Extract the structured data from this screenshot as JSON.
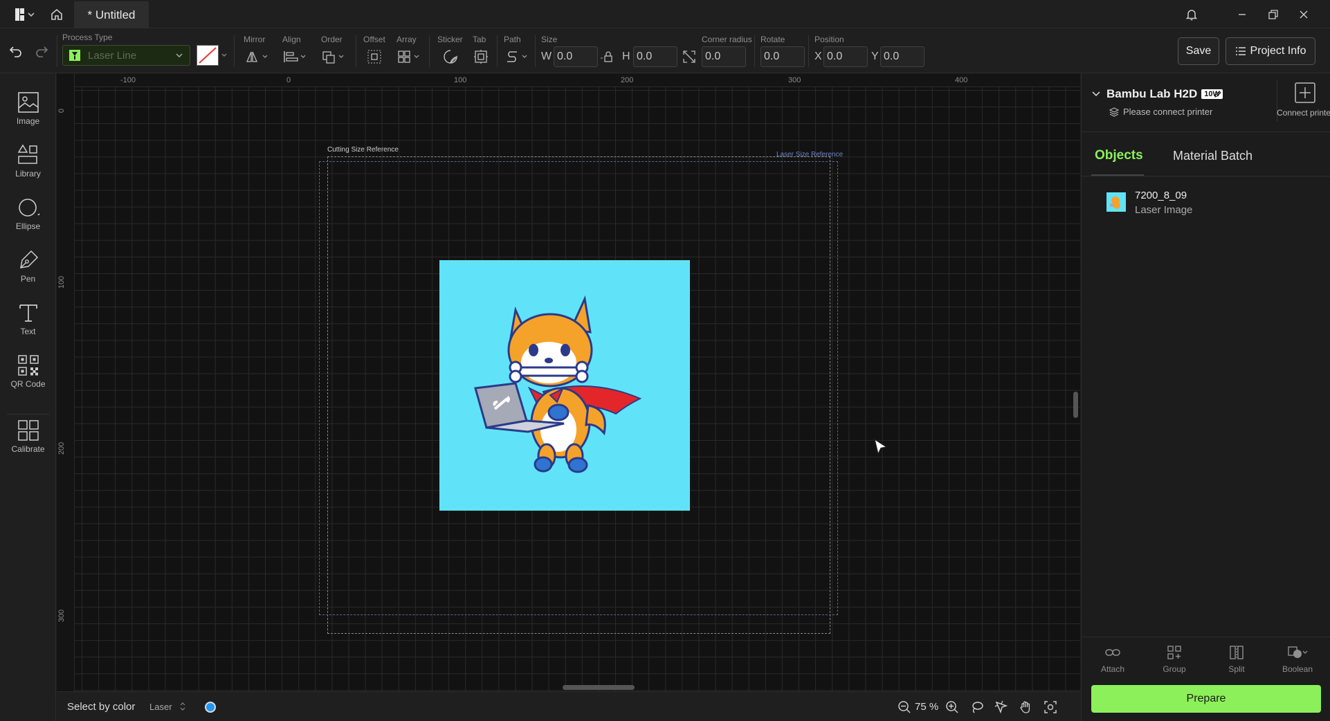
{
  "titlebar": {
    "doc_title": "* Untitled"
  },
  "toolbar": {
    "process_type_label": "Process Type",
    "process_type_value": "Laser Line",
    "mirror_label": "Mirror",
    "align_label": "Align",
    "order_label": "Order",
    "offset_label": "Offset",
    "array_label": "Array",
    "sticker_label": "Sticker",
    "tab_label": "Tab",
    "path_label": "Path",
    "size_label": "Size",
    "w_letter": "W",
    "w_value": "0.0",
    "h_letter": "H",
    "h_value": "0.0",
    "corner_radius_label": "Corner radius",
    "corner_radius_value": "0.0",
    "rotate_label": "Rotate",
    "rotate_value": "0.0",
    "position_label": "Position",
    "x_letter": "X",
    "x_value": "0.0",
    "y_letter": "Y",
    "y_value": "0.0",
    "save_label": "Save",
    "project_info_label": "Project Info"
  },
  "leftbar": {
    "tools": [
      {
        "label": "Image"
      },
      {
        "label": "Library"
      },
      {
        "label": "Ellipse"
      },
      {
        "label": "Pen"
      },
      {
        "label": "Text"
      },
      {
        "label": "QR Code"
      },
      {
        "label": "Calibrate"
      }
    ]
  },
  "canvas": {
    "ruler_top": [
      "-100",
      "0",
      "100",
      "200",
      "300",
      "400"
    ],
    "ruler_left": [
      "0",
      "100",
      "200",
      "300"
    ],
    "cutting_ref_label": "Cutting Size Reference",
    "laser_ref_label": "Laser Size Reference"
  },
  "statusbar": {
    "select_by_color": "Select by color",
    "mode": "Laser",
    "zoom": "75 %",
    "dot_color": "#2196f3"
  },
  "rightpanel": {
    "printer_name": "Bambu Lab H2D",
    "printer_badge": "10W",
    "printer_status": "Please connect printer",
    "connect_printer": "Connect printer",
    "tabs": [
      {
        "label": "Objects",
        "active": true
      },
      {
        "label": "Material Batch",
        "active": false
      }
    ],
    "objects": [
      {
        "name": "7200_8_09",
        "type": "Laser Image"
      }
    ],
    "actions": [
      {
        "label": "Attach"
      },
      {
        "label": "Group"
      },
      {
        "label": "Split"
      },
      {
        "label": "Boolean"
      }
    ],
    "prepare_label": "Prepare"
  },
  "colors": {
    "accent": "#8cf05a",
    "artwork_bg": "#60e3f8"
  }
}
